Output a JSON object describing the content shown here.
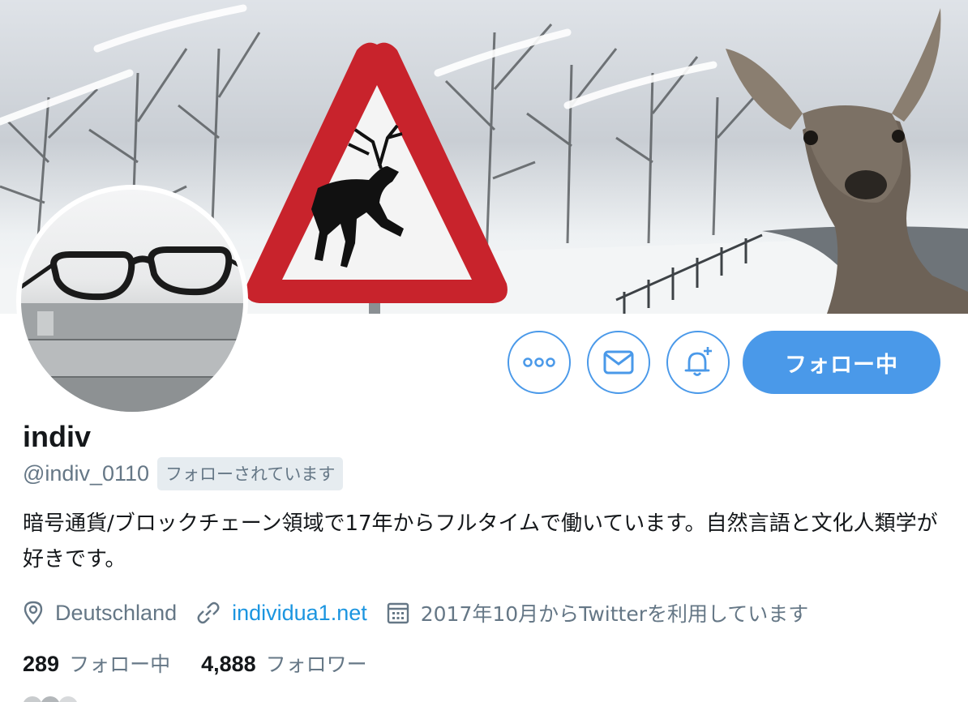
{
  "profile": {
    "name": "indiv",
    "handle": "@indiv_0110",
    "follows_you_badge": "フォローされています",
    "bio": "暗号通貨/ブロックチェーン領域で17年からフルタイムで働いています。自然言語と文化人類学が好きです。",
    "location": "Deutschland",
    "website": "individua1.net",
    "joined": "2017年10月からTwitterを利用しています"
  },
  "stats": {
    "following_count": "289",
    "following_label": "フォロー中",
    "followers_count": "4,888",
    "followers_label": "フォロワー"
  },
  "actions": {
    "more_icon": "more-icon",
    "message_icon": "mail-icon",
    "notify_icon": "bell-plus-icon",
    "follow_label": "フォロー中"
  },
  "colors": {
    "accent": "#4a99e9",
    "link": "#1b95e0",
    "secondary_text": "#657786",
    "badge_bg": "#e6ecf0"
  }
}
